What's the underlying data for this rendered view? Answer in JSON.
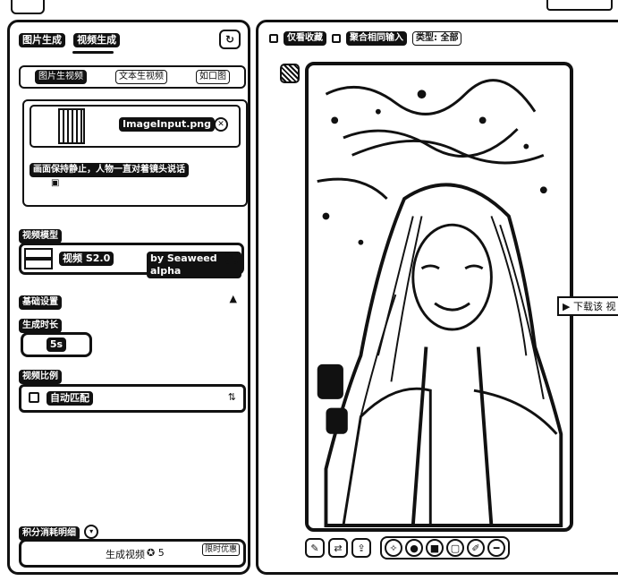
{
  "left_panel": {
    "mode_tabs": [
      "图片生成",
      "视频生成"
    ],
    "sub_tabs": [
      "图片生视频",
      "文本生视频",
      "如口图"
    ],
    "upload": {
      "file_name": "ImageInput.png",
      "prompt": "画面保持静止，人物一直对着镜头说话"
    },
    "model_section_label": "视频模型",
    "model": {
      "name": "视频 S2.0",
      "provider": "by Seaweed alpha"
    },
    "basic_settings_label": "基础设置",
    "duration_label": "生成时长",
    "duration_value": "5s",
    "ratio_label": "视频比例",
    "ratio_value": "自动匹配",
    "sound_label": "积分消耗明细",
    "generate_label": "生成视频",
    "generate_credits": "5",
    "generate_extra": "限时优惠"
  },
  "right_panel": {
    "filters": [
      "仅看收藏",
      "聚合相同输入"
    ],
    "type_filter": "类型: 全部",
    "download_tip": "▶ 下载该 视"
  },
  "icons": [
    "refresh-icon",
    "trash-icon",
    "image-icon",
    "chevron-down-icon",
    "collapse-icon",
    "checkbox-icon",
    "edit-icon",
    "regenerate-icon",
    "upload-icon",
    "magic-icon",
    "circle-icon",
    "square-icon",
    "crop-icon",
    "pen-icon",
    "more-icon",
    "heart-icon"
  ]
}
